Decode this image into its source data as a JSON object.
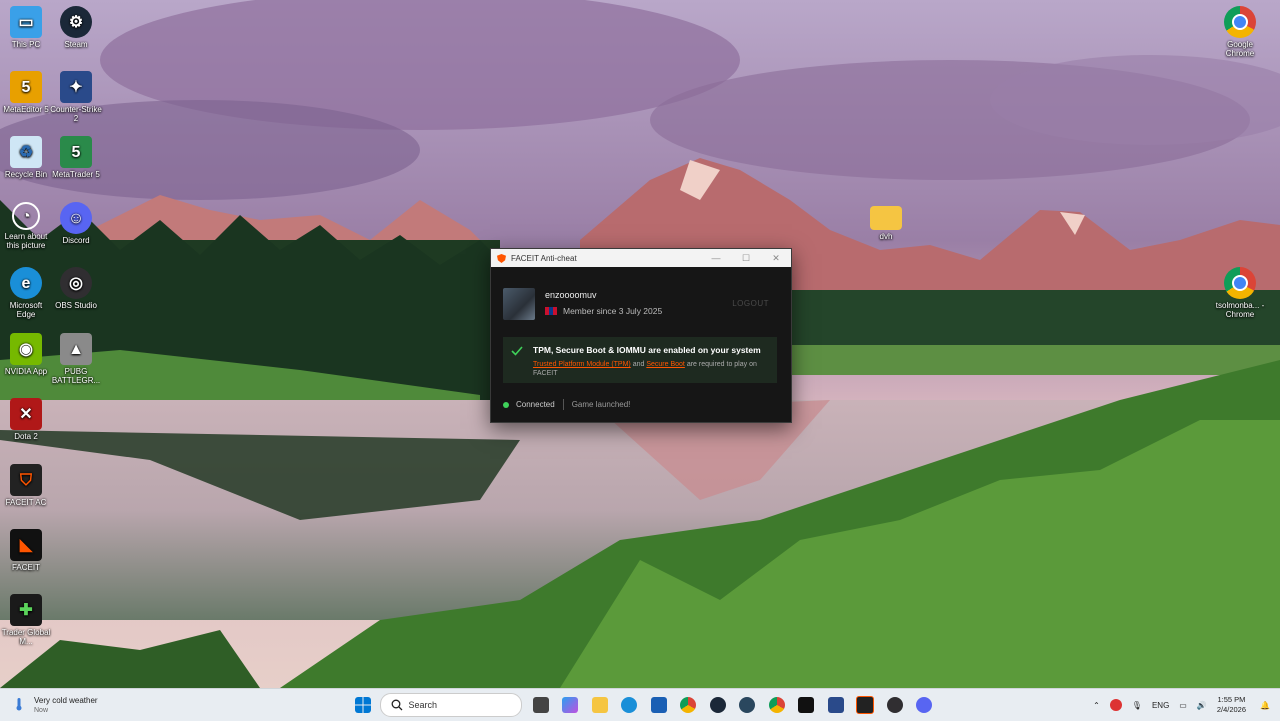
{
  "desktop": {
    "icons_left": [
      {
        "label": "This PC",
        "icon": "this-pc-icon",
        "color": "#3aa0e8"
      },
      {
        "label": "Steam",
        "icon": "steam-icon",
        "color": "#1b2838"
      },
      {
        "label": "MetaEditor 5",
        "icon": "metaeditor-icon",
        "color": "#e8a000"
      },
      {
        "label": "Counter-Strike 2",
        "icon": "counter-strike-icon",
        "color": "#d08000"
      },
      {
        "label": "Recycle Bin",
        "icon": "recycle-bin-icon",
        "color": "#cfe6f5"
      },
      {
        "label": "MetaTrader 5",
        "icon": "metatrader-icon",
        "color": "#2a8a4a"
      },
      {
        "label": "Learn about this picture",
        "icon": "learn-picture-icon",
        "color": "#333333"
      },
      {
        "label": "Discord",
        "icon": "discord-icon",
        "color": "#5865f2"
      },
      {
        "label": "Microsoft Edge",
        "icon": "edge-icon",
        "color": "#1a8fd8"
      },
      {
        "label": "OBS Studio",
        "icon": "obs-icon",
        "color": "#302e31"
      },
      {
        "label": "NVIDIA App",
        "icon": "nvidia-icon",
        "color": "#76b900"
      },
      {
        "label": "PUBG BATTLEGR...",
        "icon": "pubg-icon",
        "color": "#8a8a8a"
      },
      {
        "label": "Dota 2",
        "icon": "dota-icon",
        "color": "#b01818"
      },
      {
        "label": "FACEIT AC",
        "icon": "faceit-ac-icon",
        "color": "#ff5500"
      },
      {
        "label": "FACEIT",
        "icon": "faceit-icon",
        "color": "#111111"
      },
      {
        "label": "Trader Global M...",
        "icon": "trader-icon",
        "color": "#1a1a1a"
      }
    ],
    "icons_right": [
      {
        "label": "Google Chrome",
        "icon": "chrome-icon"
      },
      {
        "label": "dvh",
        "icon": "folder-icon"
      },
      {
        "label": "tsolmonba... - Chrome",
        "icon": "chrome-profile-icon"
      }
    ]
  },
  "faceit_window": {
    "title": "FACEIT Anti-cheat",
    "username": "enzoooomuv",
    "member_since": "Member since 3 July 2025",
    "logout": "LOGOUT",
    "notice_title": "TPM, Secure Boot & IOMMU are enabled on your system",
    "notice_link1": "Trusted Platform Module (TPM)",
    "notice_and": " and ",
    "notice_link2": "Secure Boot",
    "notice_tail": " are required to play on FACEIT",
    "status_connected": "Connected",
    "status_game": "Game launched!"
  },
  "taskbar": {
    "weather_title": "Very cold weather",
    "weather_sub": "Now",
    "search_placeholder": "Search",
    "language": "ENG",
    "time": "1:55 PM",
    "date": "2/4/2026"
  }
}
